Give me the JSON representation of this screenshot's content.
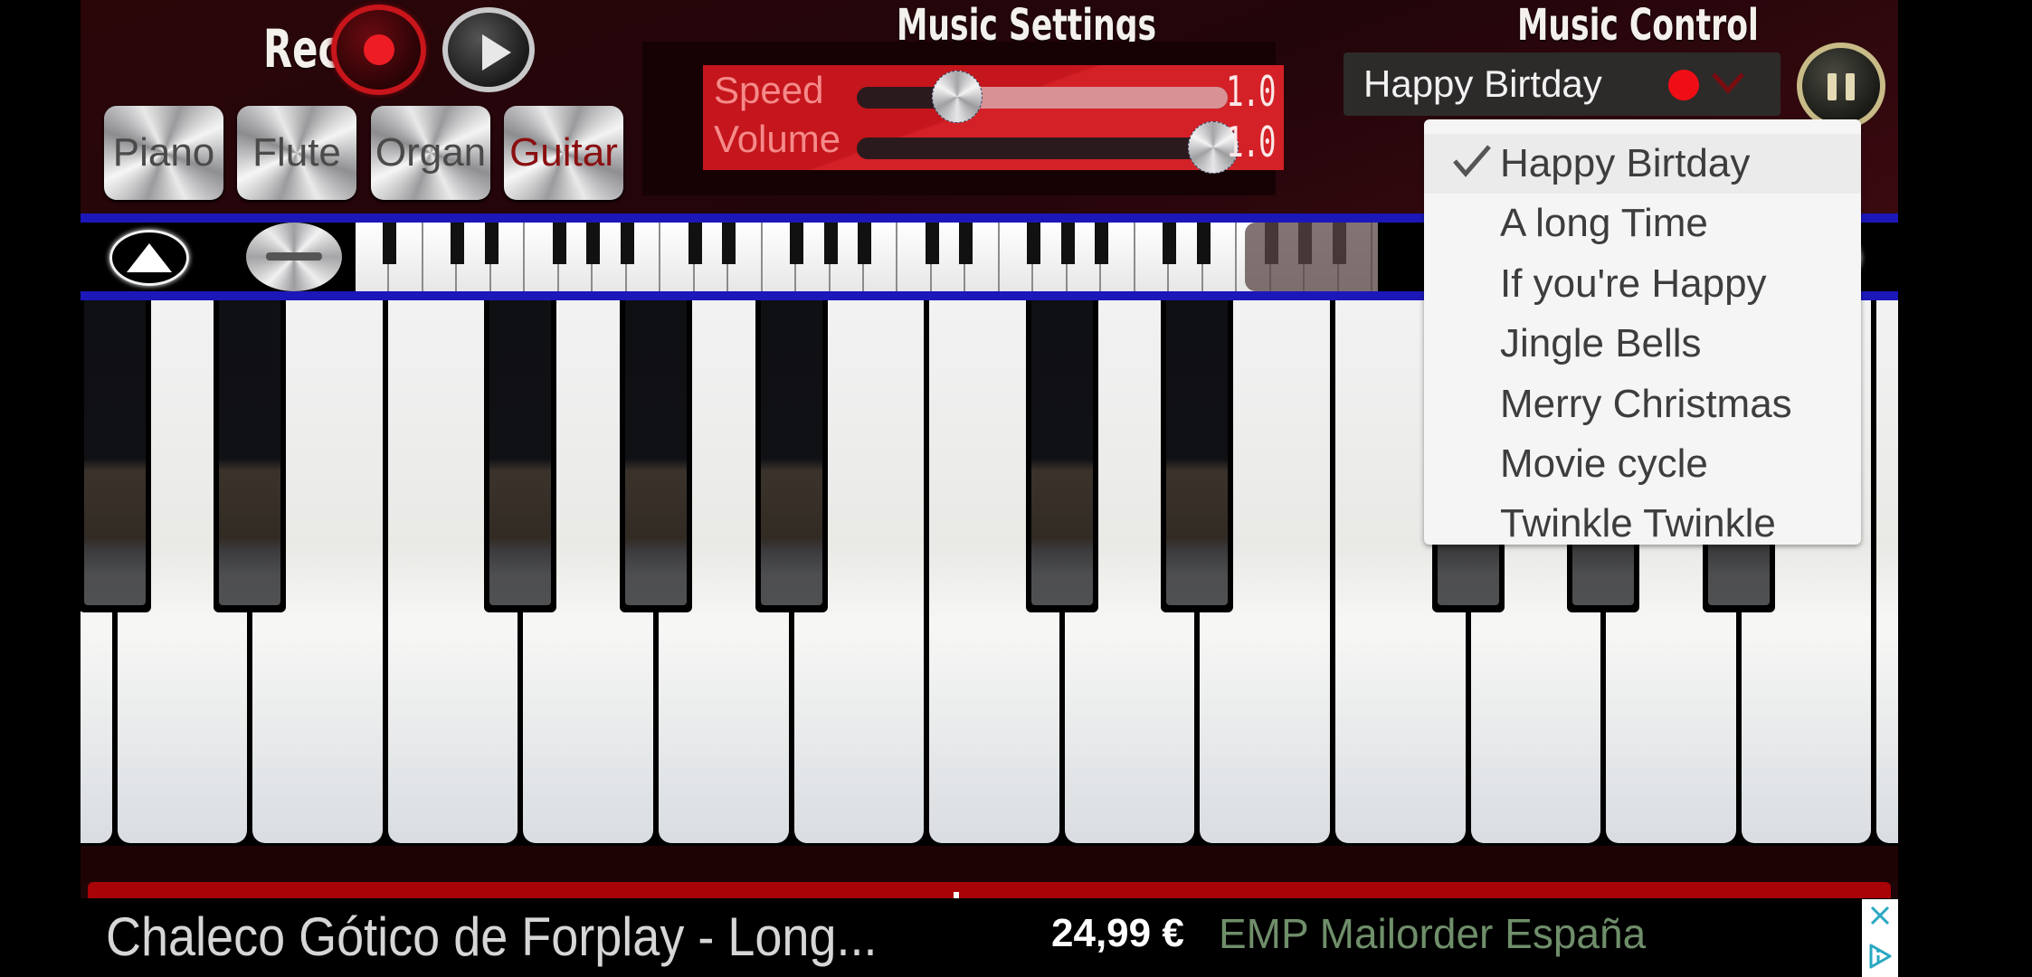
{
  "header": {
    "record_label": "Record",
    "record_button": "record-button",
    "play_button": "play-button",
    "music_settings_title": "Music Settings",
    "music_control_title": "Music Control"
  },
  "instruments": [
    {
      "label": "Piano",
      "active": false
    },
    {
      "label": "Flute",
      "active": false
    },
    {
      "label": "Organ",
      "active": false
    },
    {
      "label": "Guitar",
      "active": true
    }
  ],
  "settings": {
    "speed": {
      "label": "Speed",
      "value_text": "1.0",
      "slider_fraction": 0.27
    },
    "volume": {
      "label": "Volume",
      "value_text": "1.0",
      "slider_fraction": 0.96
    }
  },
  "music_control": {
    "selected_song": "Happy Birtday",
    "recording_indicator_color": "#f00e16",
    "songs": [
      {
        "label": "Happy Birtday",
        "checked": true
      },
      {
        "label": "A long Time",
        "checked": false
      },
      {
        "label": "If you're Happy",
        "checked": false
      },
      {
        "label": "Jingle Bells",
        "checked": false
      },
      {
        "label": "Merry Christmas",
        "checked": false
      },
      {
        "label": "Movie cycle",
        "checked": false
      },
      {
        "label": "Twinkle Twinkle",
        "checked": false
      }
    ]
  },
  "keyboard": {
    "visible_white_keys": 14,
    "black_key_pattern": [
      1,
      1,
      0,
      1,
      1,
      1,
      0,
      1,
      1,
      0,
      1,
      1,
      1,
      0
    ],
    "mini_keyboard_white_keys": 52,
    "mini_view_start_fraction": 0.87
  },
  "colors": {
    "accent_red": "#c4161c",
    "strip_blue": "#1c17b8",
    "background": "#1e0507"
  },
  "ad": {
    "title": "Chaleco Gótico de Forplay - Long...",
    "price": "24,99 €",
    "seller": "EMP Mailorder España",
    "close_icon": "close-icon",
    "adchoices_icon": "adchoices-icon"
  }
}
